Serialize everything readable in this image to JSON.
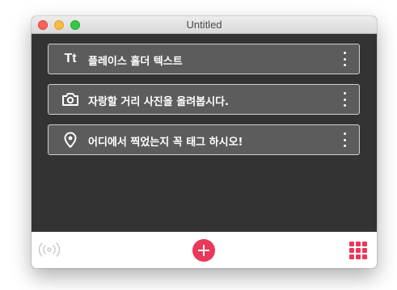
{
  "window": {
    "title": "Untitled"
  },
  "cards": [
    {
      "icon": "text-icon",
      "icon_text": "Tt",
      "label": "플레이스 홀더 텍스트"
    },
    {
      "icon": "camera-icon",
      "label": "자랑할 거리 사진을 올려봅시다."
    },
    {
      "icon": "location-pin-icon",
      "label": "어디에서 찍었는지 꼭 태그 하시오!"
    }
  ],
  "bottombar": {
    "left_icon": "beacon-icon",
    "center_icon": "add-icon",
    "right_icon": "grid-icon"
  },
  "colors": {
    "background": "#333333",
    "card": "#5c5c5c",
    "card_border": "#d0d0d0",
    "accent": "#e8385b",
    "inactive_icon": "#c8c8c8"
  }
}
